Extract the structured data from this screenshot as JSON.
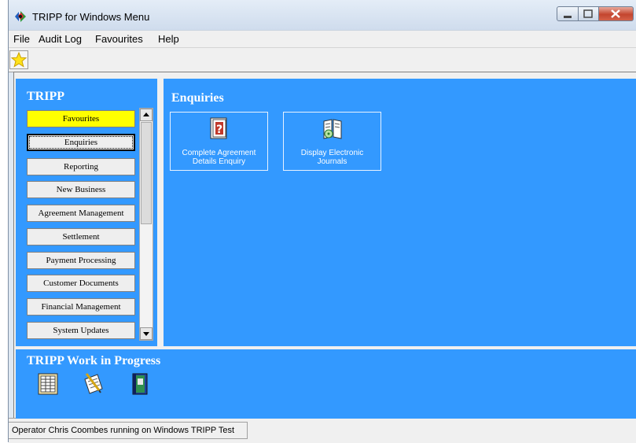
{
  "window": {
    "title": "TRIPP for Windows Menu"
  },
  "menubar": {
    "items": [
      "File",
      "Audit Log",
      "Favourites",
      "Help"
    ]
  },
  "left_panel": {
    "title": "TRIPP",
    "nav": [
      "Favourites",
      "Enquiries",
      "Reporting",
      "New Business",
      "Agreement Management",
      "Settlement",
      "Payment Processing",
      "Customer Documents",
      "Financial Management",
      "System Updates"
    ],
    "active_item": "Favourites",
    "focused_item": "Enquiries"
  },
  "main_panel": {
    "title": "Enquiries",
    "tiles": [
      {
        "label_line1": "Complete Agreement",
        "label_line2": "Details Enquiry",
        "icon": "agreement-enquiry-icon"
      },
      {
        "label_line1": "Display Electronic",
        "label_line2": "Journals",
        "icon": "electronic-journals-icon"
      }
    ]
  },
  "wip_panel": {
    "title": "TRIPP Work in Progress",
    "icons": [
      "ledger-icon",
      "document-edit-icon",
      "binder-icon"
    ]
  },
  "status": {
    "text": "Operator Chris Coombes running on Windows TRIPP Test"
  },
  "colors": {
    "panel_blue": "#3399ff",
    "active_yellow": "#ffff00"
  }
}
